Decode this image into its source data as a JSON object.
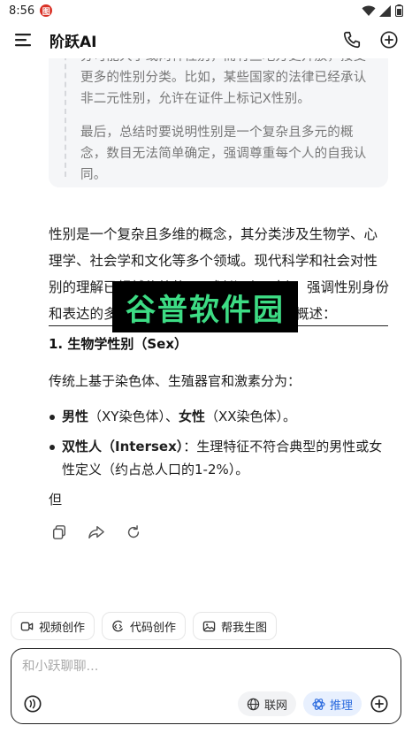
{
  "status": {
    "time": "8:56",
    "badge": "图"
  },
  "header": {
    "title": "阶跃AI"
  },
  "quote": {
    "p1": "分可能大于或两种性别，而有些地方更开放，接受更多的性别分类。比如，某些国家的法律已经承认非二元性别，允许在证件上标记X性别。",
    "p2": "最后，总结时要说明性别是一个复杂且多元的概念，数目无法简单确定，强调尊重每个人的自我认同。"
  },
  "answer": {
    "intro": "性别是一个复杂且多维的概念，其分类涉及生物学、心理学、社会学和文化等多个领域。现代科学和社会对性别的理解已超越传统的二元划分（男/女），强调性别身份和表达的多样性。以下是对性别多样性的概述：",
    "section1_title": "1. 生物学性别（Sex）",
    "section1_text": "传统上基于染色体、生殖器官和激素分为：",
    "bullets": [
      {
        "bold": "男性",
        "rest": "（XY染色体）、",
        "bold2": "女性",
        "rest2": "（XX染色体）。"
      },
      {
        "bold": "双性人（Intersex）",
        "rest": "：生理特征不符合典型的男性或女性定义（约占总人口的1-2%）。"
      }
    ],
    "partial": "但"
  },
  "watermark": {
    "text": "谷普软件园"
  },
  "quick_actions": [
    "视频创作",
    "代码创作",
    "帮我生图"
  ],
  "composer": {
    "placeholder": "和小跃聊聊...",
    "web_label": "联网",
    "reason_label": "推理"
  },
  "colors": {
    "accent": "#2d6cdf",
    "watermark": "#3ddc84"
  }
}
